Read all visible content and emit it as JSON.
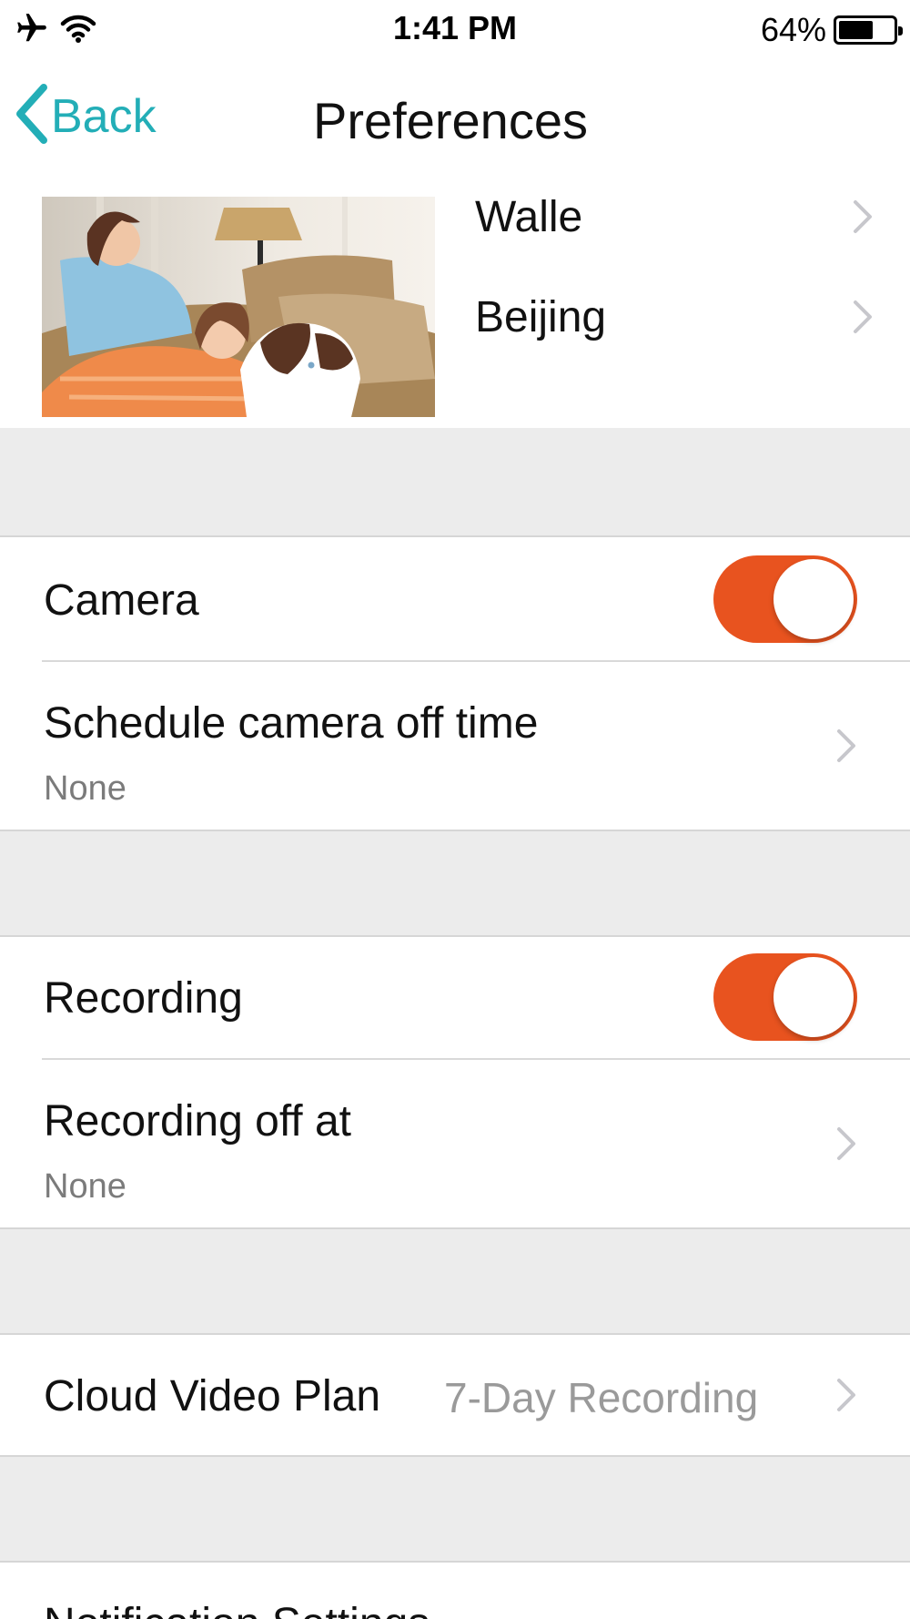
{
  "status": {
    "time": "1:41 PM",
    "battery_percent": "64%",
    "battery_level": 0.64,
    "icons": [
      "airplane-icon",
      "wifi-icon",
      "battery-icon"
    ]
  },
  "nav": {
    "back_label": "Back",
    "title": "Preferences"
  },
  "profile": {
    "name": "Walle",
    "location": "Beijing"
  },
  "camera": {
    "label": "Camera",
    "enabled": true,
    "schedule_label": "Schedule camera off time",
    "schedule_value": "None"
  },
  "recording": {
    "label": "Recording",
    "enabled": true,
    "off_label": "Recording off at",
    "off_value": "None"
  },
  "cloud": {
    "label": "Cloud Video Plan",
    "value": "7-Day Recording"
  },
  "notifications": {
    "label": "Notification Settings"
  },
  "colors": {
    "accent": "#23aeb7",
    "toggle_on": "#e8531f",
    "group_background": "#ececec"
  }
}
